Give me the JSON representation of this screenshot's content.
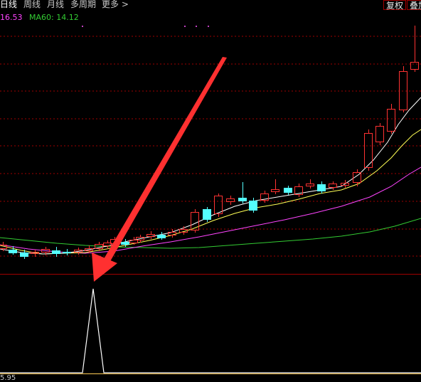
{
  "tabs": [
    "日线",
    "周线",
    "月线",
    "多周期",
    "更多 >"
  ],
  "buttons": {
    "fuquan": "复权",
    "diejia": "叠加"
  },
  "legend": {
    "val1": "16.53",
    "val2": "MA60: 14.12"
  },
  "indicator": {
    "bottom_value": "5.95"
  },
  "colors": {
    "up_candle": "#ff3232",
    "down_candle": "#54ffff",
    "ma_short": "#ffffff",
    "ma_mid": "#ffff55",
    "ma_long": "#ff44ff",
    "ma60": "#33cc33",
    "grid": "#a00000",
    "arrow": "#ff3030",
    "indicator_line": "#ffffff",
    "baseline": "#ffcc55"
  }
}
